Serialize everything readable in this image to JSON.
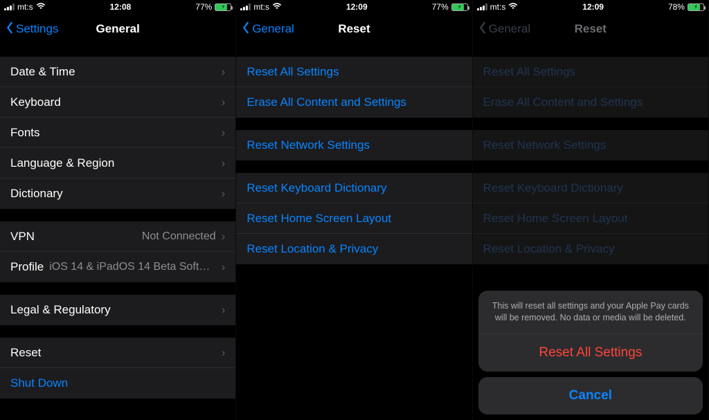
{
  "screen1": {
    "status": {
      "carrier": "mt:s",
      "time": "12:08",
      "battery_pct": "77%",
      "battery_fill": 77
    },
    "nav": {
      "back": "Settings",
      "title": "General"
    },
    "group1": [
      {
        "label": "Date & Time"
      },
      {
        "label": "Keyboard"
      },
      {
        "label": "Fonts"
      },
      {
        "label": "Language & Region"
      },
      {
        "label": "Dictionary"
      }
    ],
    "group2": [
      {
        "label": "VPN",
        "value": "Not Connected"
      },
      {
        "label": "Profile",
        "value": "iOS 14 & iPadOS 14 Beta Softwar..."
      }
    ],
    "group3": [
      {
        "label": "Legal & Regulatory"
      }
    ],
    "group4": [
      {
        "label": "Reset",
        "chevron": true
      },
      {
        "label": "Shut Down",
        "blue": true
      }
    ]
  },
  "screen2": {
    "status": {
      "carrier": "mt:s",
      "time": "12:09",
      "battery_pct": "77%",
      "battery_fill": 77
    },
    "nav": {
      "back": "General",
      "title": "Reset"
    },
    "g1": [
      "Reset All Settings",
      "Erase All Content and Settings"
    ],
    "g2": [
      "Reset Network Settings"
    ],
    "g3": [
      "Reset Keyboard Dictionary",
      "Reset Home Screen Layout",
      "Reset Location & Privacy"
    ]
  },
  "screen3": {
    "status": {
      "carrier": "mt:s",
      "time": "12:09",
      "battery_pct": "78%",
      "battery_fill": 78
    },
    "nav": {
      "back": "General",
      "title": "Reset"
    },
    "g1": [
      "Reset All Settings",
      "Erase All Content and Settings"
    ],
    "g2": [
      "Reset Network Settings"
    ],
    "g3": [
      "Reset Keyboard Dictionary",
      "Reset Home Screen Layout",
      "Reset Location & Privacy"
    ],
    "sheet": {
      "message": "This will reset all settings and your Apple Pay cards will be removed. No data or media will be deleted.",
      "destructive": "Reset All Settings",
      "cancel": "Cancel"
    }
  }
}
